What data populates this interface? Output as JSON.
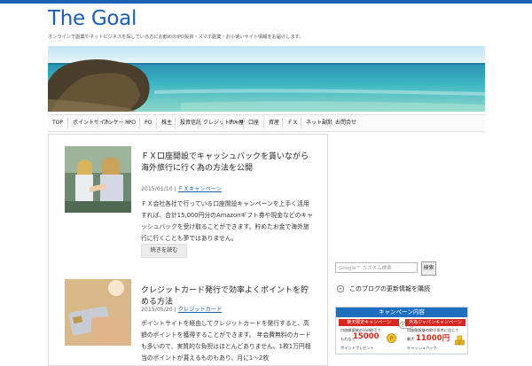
{
  "site": {
    "title": "The Goal",
    "tagline": "オンラインで副業やネットビジネスを探している方にお勧めのIPO投資・スマホ副業・お小遣いサイト情報をお届けします。"
  },
  "nav": {
    "items": [
      "TOP",
      "ポイントサイト",
      "アンケート",
      "IPO",
      "PO",
      "株主",
      "投資信託",
      "クレジットカード",
      "ＦＸ屋",
      "口座",
      "資産",
      "ＦＸ",
      "ネット副業",
      "お問合せ"
    ]
  },
  "posts": [
    {
      "title": "ＦＸ口座開設でキャッシュバックを貰いながら海外旅行に行く為の方法を公開",
      "date": "2015/01/10",
      "category": "ＦＸキャンペーン",
      "excerpt": "ＦＸ会社各社で行っている口座開設キャンペーンを上手く活用すれば、合計15,000円分のAmazonギフト券や現金などのキャッシュバックを受け取ることができます。貯めたお金で海外旅行に行くことも夢ではありません。",
      "more": "続きを読む"
    },
    {
      "title": "クレジットカード発行で効率よくポイントを貯める方法",
      "date": "2015/05/20",
      "category": "クレジットカード",
      "excerpt": "ポイントサイトを経由してクレジットカードを発行すると、高額のポイントを獲得することができます。 年会費無料のカードも多いので、実質的な負担はほとんどありません。1枚1万円相当のポイントが貰えるものもあり、月に1〜2枚"
    }
  ],
  "sidebar": {
    "search_placeholder": "Google™ カスタム検索",
    "search_button": "検索",
    "rss_label": "このブログの更新情報を購読",
    "banner": {
      "head": "キャンペーン内容",
      "left_tag": "楽天限定キャンペーン",
      "left_line1": "口座開設後の1lot取引で",
      "left_line2": "もれなく",
      "left_big": "15000",
      "left_line3": "ポイントプレゼント",
      "vs": "さらに",
      "right_tag": "外為ジャパンキャンペーン",
      "right_line1": "口座開設後の取引条件に応じて",
      "right_line2": "最大",
      "right_big": "11000円",
      "right_line3": "キャッシュバック"
    }
  },
  "colors": {
    "brand": "#1a5fb4",
    "accent_red": "#d7261f"
  }
}
